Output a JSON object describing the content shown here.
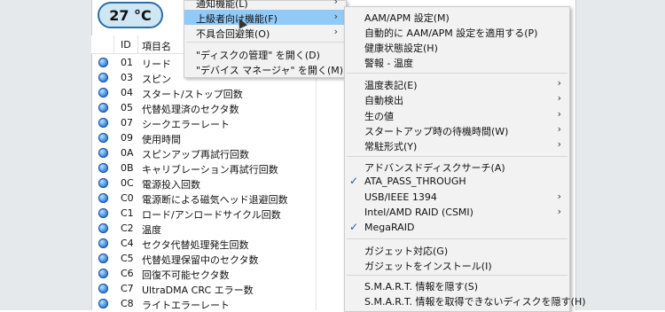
{
  "temperature": "27 °C",
  "table": {
    "headers": {
      "id": "ID",
      "name": "項目名"
    },
    "rows": [
      {
        "id": "01",
        "name": "リード"
      },
      {
        "id": "03",
        "name": "スピン"
      },
      {
        "id": "04",
        "name": "スタート/ストップ回数"
      },
      {
        "id": "05",
        "name": "代替処理済のセクタ数"
      },
      {
        "id": "07",
        "name": "シークエラーレート"
      },
      {
        "id": "09",
        "name": "使用時間"
      },
      {
        "id": "0A",
        "name": "スピンアップ再試行回数"
      },
      {
        "id": "0B",
        "name": "キャリブレーション再試行回数"
      },
      {
        "id": "0C",
        "name": "電源投入回数"
      },
      {
        "id": "C0",
        "name": "電源断による磁気ヘッド退避回数"
      },
      {
        "id": "C1",
        "name": "ロード/アンロードサイクル回数"
      },
      {
        "id": "C2",
        "name": "温度"
      },
      {
        "id": "C4",
        "name": "セクタ代替処理発生回数"
      },
      {
        "id": "C5",
        "name": "代替処理保留中のセクタ数"
      },
      {
        "id": "C6",
        "name": "回復不可能セクタ数"
      },
      {
        "id": "C7",
        "name": "UltraDMA CRC エラー数"
      },
      {
        "id": "C8",
        "name": "ライトエラーレート"
      }
    ]
  },
  "menu1": {
    "items": [
      {
        "label": "通知機能(L)"
      },
      {
        "label": "上級者向け機能(F)"
      },
      {
        "label": "不具合回避策(O)"
      },
      {
        "label": "\"ディスクの管理\" を開く(D)"
      },
      {
        "label": "\"デバイス マネージャ\" を開く(M)"
      }
    ]
  },
  "menu2": {
    "items": [
      {
        "label": "AAM/APM 設定(M)"
      },
      {
        "label": "自動的に AAM/APM 設定を適用する(P)"
      },
      {
        "label": "健康状態設定(H)"
      },
      {
        "label": "警報 - 温度"
      },
      {
        "label": "温度表記(E)"
      },
      {
        "label": "自動検出"
      },
      {
        "label": "生の値"
      },
      {
        "label": "スタートアップ時の待機時間(W)"
      },
      {
        "label": "常駐形式(Y)"
      },
      {
        "label": "アドバンスドディスクサーチ(A)"
      },
      {
        "label": "ATA_PASS_THROUGH"
      },
      {
        "label": "USB/IEEE 1394"
      },
      {
        "label": "Intel/AMD RAID (CSMI)"
      },
      {
        "label": "MegaRAID"
      },
      {
        "label": "ガジェット対応(G)"
      },
      {
        "label": "ガジェットをインストール(I)"
      },
      {
        "label": "S.M.A.R.T. 情報を隠す(S)"
      },
      {
        "label": "S.M.A.R.T. 情報を取得できないディスクを隠す(H)"
      }
    ]
  },
  "icons": {
    "submenu": "chevron-right-icon",
    "check": "checkmark-icon",
    "status": "status-dot-icon"
  },
  "colors": {
    "highlight": "#91c9f7",
    "status_dot": "#3d8ee6",
    "badge_border": "#2c6fa6"
  }
}
